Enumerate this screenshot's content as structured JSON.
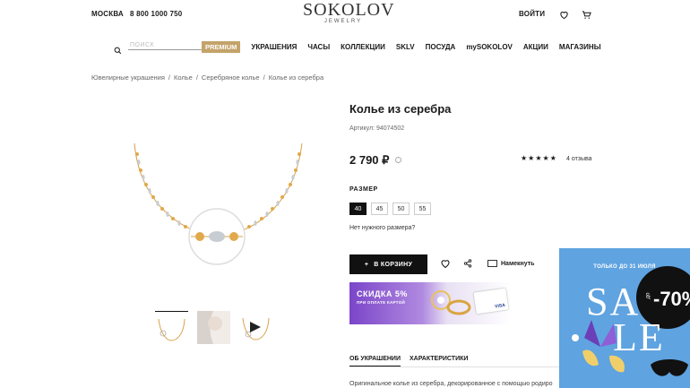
{
  "header": {
    "city": "МОСКВА",
    "phone": "8 800 1000 750",
    "logo_main": "SOKOLOV",
    "logo_sub": "JEWELRY",
    "login": "ВОЙТИ"
  },
  "nav": {
    "search_placeholder": "ПОИСК",
    "premium": "PREMIUM",
    "items": [
      "УКРАШЕНИЯ",
      "ЧАСЫ",
      "КОЛЛЕКЦИИ",
      "SKLV",
      "ПОСУДА",
      "mySOKOLOV",
      "АКЦИИ",
      "МАГАЗИНЫ"
    ]
  },
  "breadcrumbs": [
    "Ювелирные украшения",
    "Колье",
    "Серебряное колье",
    "Колье из серебра"
  ],
  "product": {
    "title": "Колье из серебра",
    "sku": "Артикул: 94074502",
    "price": "2 790 ₽",
    "stars": "★★★★★",
    "reviews": "4 отзыва",
    "size_label": "РАЗМЕР",
    "sizes": [
      "40",
      "45",
      "50",
      "55"
    ],
    "selected_size": "40",
    "no_size": "Нет нужного размера?",
    "cart_button": "В КОРЗИНУ",
    "notify": "Намекнуть"
  },
  "promo": {
    "big": "СКИДКА 5%",
    "small": "ПРИ ОПЛАТЕ КАРТОЙ",
    "card_brand": "VISA"
  },
  "tabs": [
    "ОБ УКРАШЕНИИ",
    "ХАРАКТЕРИСТИКИ"
  ],
  "description": "Оригинальное колье из серебра, декорированное с помощью родиро",
  "sale_banner": {
    "top": "ТОЛЬКО ДО 31 ИЮЛЯ",
    "word1": "SA",
    "word2": "LE",
    "upto": "до",
    "percent": "-70%"
  },
  "colors": {
    "premium": "#c3a36a",
    "promo_purple": "#7b45c9",
    "sale_blue": "#5fa3e0"
  }
}
